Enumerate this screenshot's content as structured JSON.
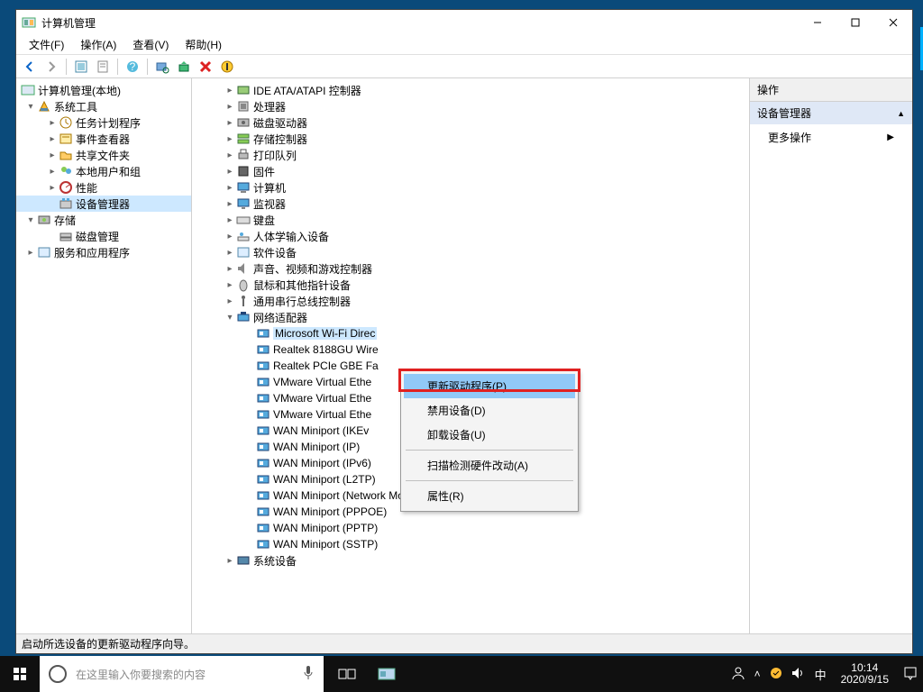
{
  "window": {
    "title": "计算机管理",
    "status": "启动所选设备的更新驱动程序向导。"
  },
  "menubar": [
    "文件(F)",
    "操作(A)",
    "查看(V)",
    "帮助(H)"
  ],
  "left_tree": {
    "root": "计算机管理(本地)",
    "groups": [
      {
        "label": "系统工具",
        "expanded": true,
        "children": [
          "任务计划程序",
          "事件查看器",
          "共享文件夹",
          "本地用户和组",
          "性能",
          "设备管理器"
        ],
        "selected_index": 5
      },
      {
        "label": "存储",
        "expanded": true,
        "children": [
          "磁盘管理"
        ]
      },
      {
        "label": "服务和应用程序",
        "expanded": false,
        "children": []
      }
    ]
  },
  "center_tree": [
    {
      "indent": 1,
      "twisty": ">",
      "icon": "ide",
      "label": "IDE ATA/ATAPI 控制器"
    },
    {
      "indent": 1,
      "twisty": ">",
      "icon": "cpu",
      "label": "处理器"
    },
    {
      "indent": 1,
      "twisty": ">",
      "icon": "disk",
      "label": "磁盘驱动器"
    },
    {
      "indent": 1,
      "twisty": ">",
      "icon": "storage",
      "label": "存储控制器"
    },
    {
      "indent": 1,
      "twisty": ">",
      "icon": "printer",
      "label": "打印队列"
    },
    {
      "indent": 1,
      "twisty": ">",
      "icon": "firmware",
      "label": "固件"
    },
    {
      "indent": 1,
      "twisty": ">",
      "icon": "computer",
      "label": "计算机"
    },
    {
      "indent": 1,
      "twisty": ">",
      "icon": "monitor",
      "label": "监视器"
    },
    {
      "indent": 1,
      "twisty": ">",
      "icon": "keyboard",
      "label": "键盘"
    },
    {
      "indent": 1,
      "twisty": ">",
      "icon": "hid",
      "label": "人体学输入设备"
    },
    {
      "indent": 1,
      "twisty": ">",
      "icon": "software",
      "label": "软件设备"
    },
    {
      "indent": 1,
      "twisty": ">",
      "icon": "audio",
      "label": "声音、视频和游戏控制器"
    },
    {
      "indent": 1,
      "twisty": ">",
      "icon": "mouse",
      "label": "鼠标和其他指针设备"
    },
    {
      "indent": 1,
      "twisty": ">",
      "icon": "usb",
      "label": "通用串行总线控制器"
    },
    {
      "indent": 1,
      "twisty": "v",
      "icon": "net",
      "label": "网络适配器"
    },
    {
      "indent": 2,
      "twisty": "",
      "icon": "nic",
      "label": "Microsoft Wi-Fi Direc",
      "hl": true
    },
    {
      "indent": 2,
      "twisty": "",
      "icon": "nic",
      "label": "Realtek 8188GU Wire"
    },
    {
      "indent": 2,
      "twisty": "",
      "icon": "nic",
      "label": "Realtek PCIe GBE Fa"
    },
    {
      "indent": 2,
      "twisty": "",
      "icon": "nic",
      "label": "VMware Virtual Ethe"
    },
    {
      "indent": 2,
      "twisty": "",
      "icon": "nic",
      "label": "VMware Virtual Ethe"
    },
    {
      "indent": 2,
      "twisty": "",
      "icon": "nic",
      "label": "VMware Virtual Ethe"
    },
    {
      "indent": 2,
      "twisty": "",
      "icon": "nic",
      "label": "WAN Miniport (IKEv"
    },
    {
      "indent": 2,
      "twisty": "",
      "icon": "nic",
      "label": "WAN Miniport (IP)"
    },
    {
      "indent": 2,
      "twisty": "",
      "icon": "nic",
      "label": "WAN Miniport (IPv6)"
    },
    {
      "indent": 2,
      "twisty": "",
      "icon": "nic",
      "label": "WAN Miniport (L2TP)"
    },
    {
      "indent": 2,
      "twisty": "",
      "icon": "nic",
      "label": "WAN Miniport (Network Monitor)"
    },
    {
      "indent": 2,
      "twisty": "",
      "icon": "nic",
      "label": "WAN Miniport (PPPOE)"
    },
    {
      "indent": 2,
      "twisty": "",
      "icon": "nic",
      "label": "WAN Miniport (PPTP)"
    },
    {
      "indent": 2,
      "twisty": "",
      "icon": "nic",
      "label": "WAN Miniport (SSTP)"
    },
    {
      "indent": 1,
      "twisty": ">",
      "icon": "sys",
      "label": "系统设备"
    }
  ],
  "right_pane": {
    "header": "操作",
    "section": "设备管理器",
    "more": "更多操作"
  },
  "context_menu": {
    "items": [
      {
        "label": "更新驱动程序(P)",
        "hl": true
      },
      {
        "label": "禁用设备(D)"
      },
      {
        "label": "卸载设备(U)"
      },
      {
        "sep": true
      },
      {
        "label": "扫描检测硬件改动(A)"
      },
      {
        "sep": true
      },
      {
        "label": "属性(R)"
      }
    ]
  },
  "taskbar": {
    "search_placeholder": "在这里输入你要搜索的内容",
    "ime": "中",
    "time": "10:14",
    "date": "2020/9/15"
  }
}
